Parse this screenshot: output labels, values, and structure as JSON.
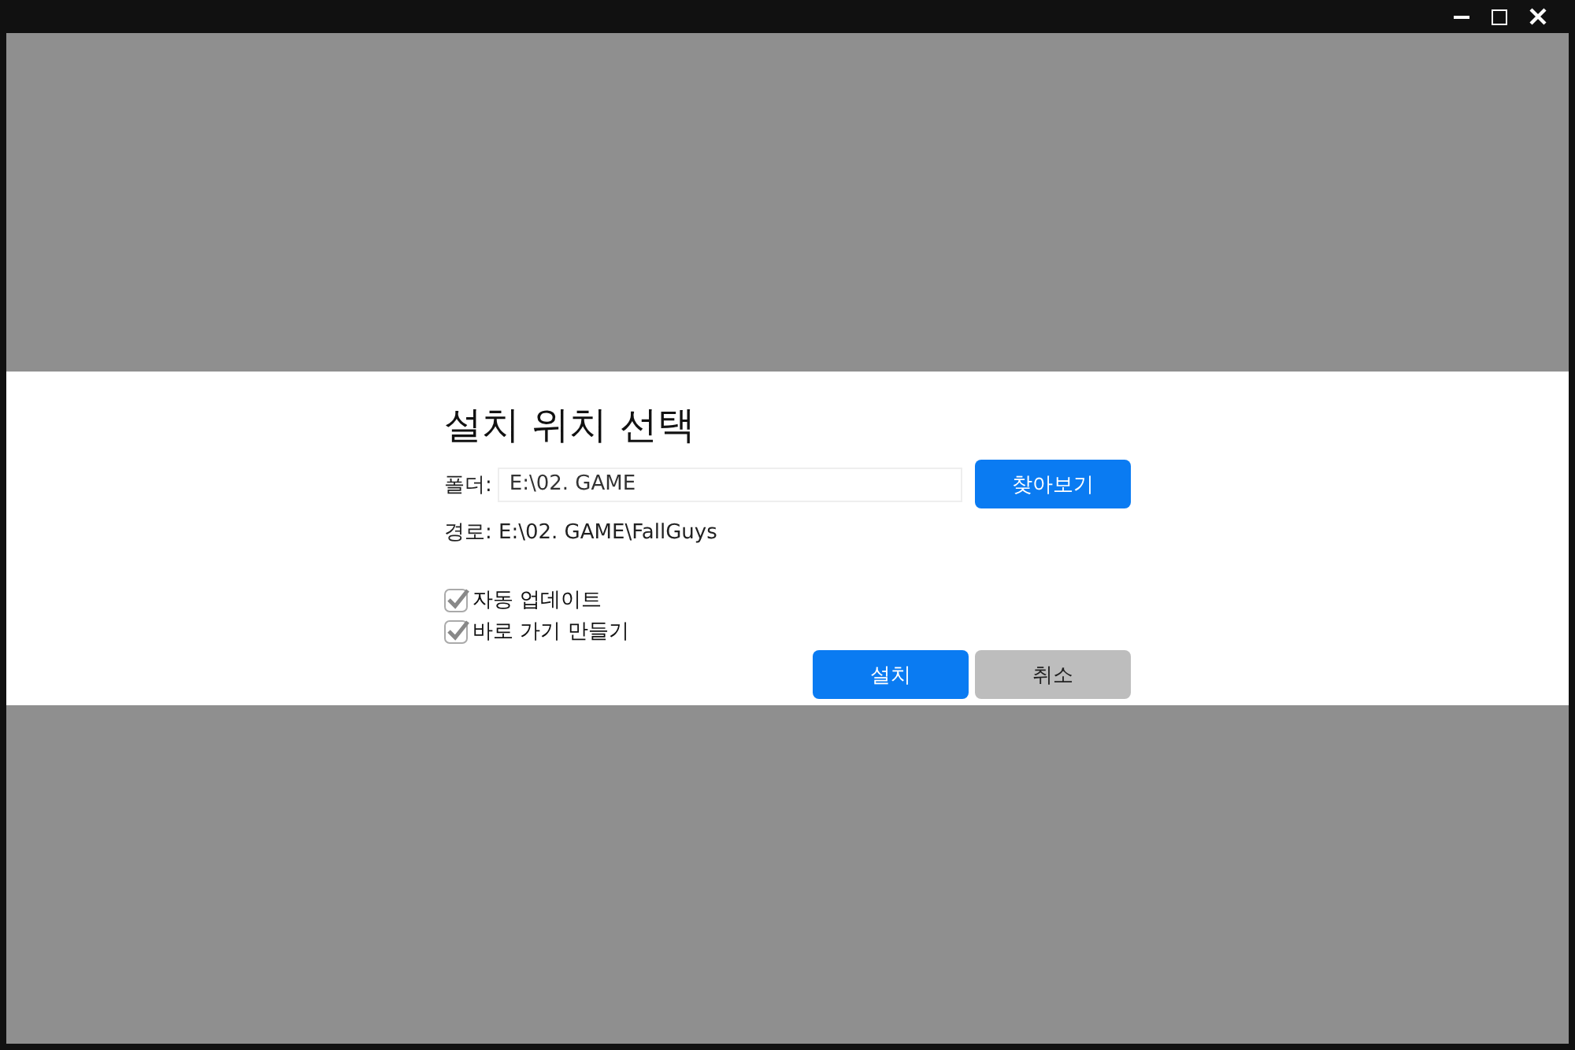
{
  "dialog": {
    "title": "설치 위치 선택",
    "folder_label": "폴더:",
    "folder_value": "E:\\02. GAME",
    "browse_button": "찾아보기",
    "path_label": "경로:",
    "path_value": "E:\\02. GAME\\FallGuys",
    "options": [
      {
        "label": "자동 업데이트",
        "checked": true
      },
      {
        "label": "바로 가기 만들기",
        "checked": true
      }
    ],
    "install_button": "설치",
    "cancel_button": "취소"
  }
}
